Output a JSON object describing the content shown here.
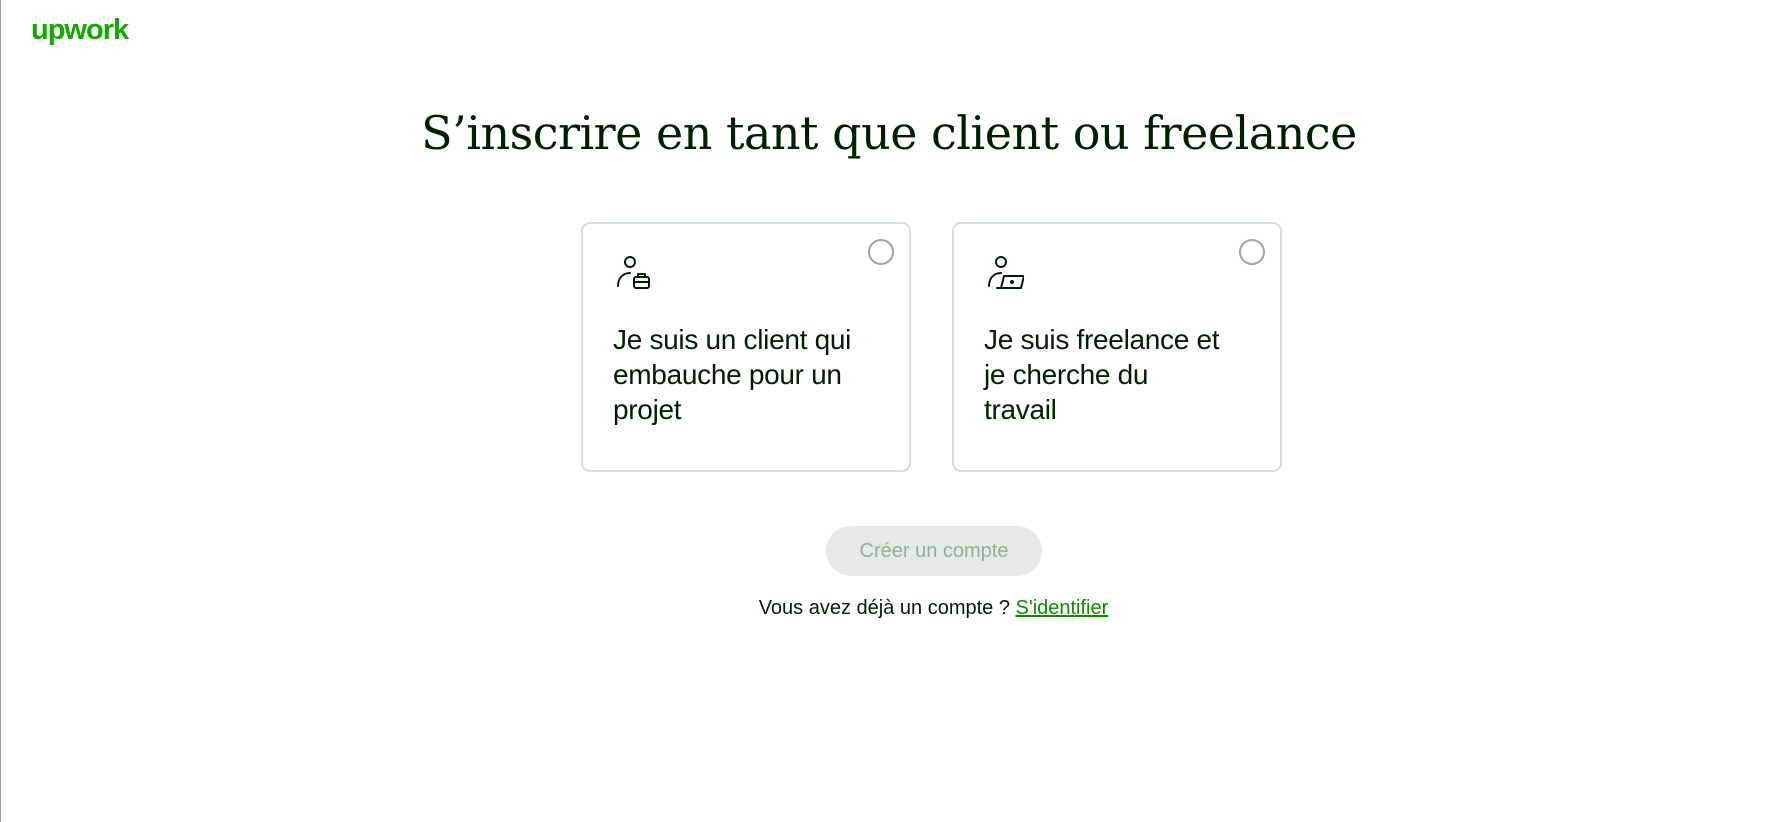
{
  "brand": {
    "logo_text": "upwork",
    "accent_color": "#14a800",
    "link_color": "#108a00"
  },
  "page": {
    "title": "S’inscrire en tant que client ou freelance"
  },
  "options": [
    {
      "icon": "client-briefcase-icon",
      "label": "Je suis un client qui embauche pour un projet",
      "selected": false
    },
    {
      "icon": "freelancer-laptop-icon",
      "label": "Je suis freelance et je cherche du travail",
      "selected": false
    }
  ],
  "actions": {
    "create_account_label": "Créer un compte",
    "create_account_enabled": false
  },
  "login": {
    "prompt": "Vous avez déjà un compte ?",
    "link_label": "S'identifier"
  }
}
